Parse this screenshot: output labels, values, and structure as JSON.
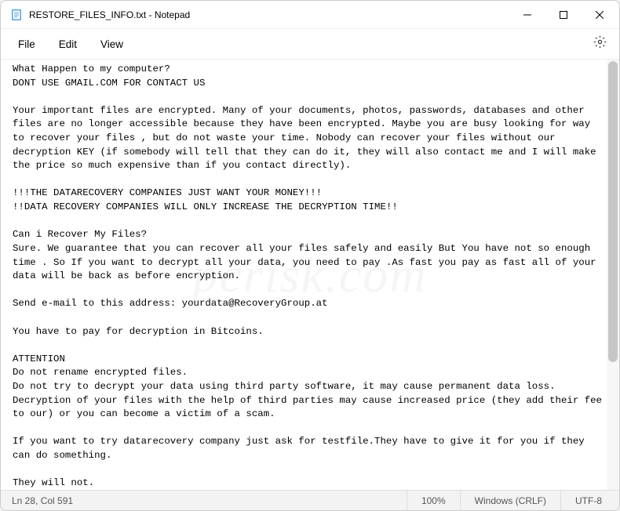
{
  "titlebar": {
    "title": "RESTORE_FILES_INFO.txt - Notepad"
  },
  "menubar": {
    "file": "File",
    "edit": "Edit",
    "view": "View"
  },
  "content": "What Happen to my computer?\nDONT USE GMAIL.COM FOR CONTACT US\n\nYour important files are encrypted. Many of your documents, photos, passwords, databases and other files are no longer accessible because they have been encrypted. Maybe you are busy looking for way to recover your files , but do not waste your time. Nobody can recover your files without our decryption KEY (if somebody will tell that they can do it, they will also contact me and I will make the price so much expensive than if you contact directly).\n\n!!!THE DATARECOVERY COMPANIES JUST WANT YOUR MONEY!!!\n!!DATA RECOVERY COMPANIES WILL ONLY INCREASE THE DECRYPTION TIME!!\n\nCan i Recover My Files?\nSure. We guarantee that you can recover all your files safely and easily But You have not so enough time . So If you want to decrypt all your data, you need to pay .As fast you pay as fast all of your data will be back as before encryption.\n\nSend e-mail to this address: yourdata@RecoveryGroup.at\n\nYou have to pay for decryption in Bitcoins.\n\nATTENTION\nDo not rename encrypted files.\nDo not try to decrypt your data using third party software, it may cause permanent data loss.\nDecryption of your files with the help of third parties may cause increased price (they add their fee to our) or you can become a victim of a scam.\n\nIf you want to try datarecovery company just ask for testfile.They have to give it for you if they can do something.\n\nThey will not.",
  "statusbar": {
    "position": "Ln 28, Col 591",
    "zoom": "100%",
    "line_ending": "Windows (CRLF)",
    "encoding": "UTF-8"
  }
}
